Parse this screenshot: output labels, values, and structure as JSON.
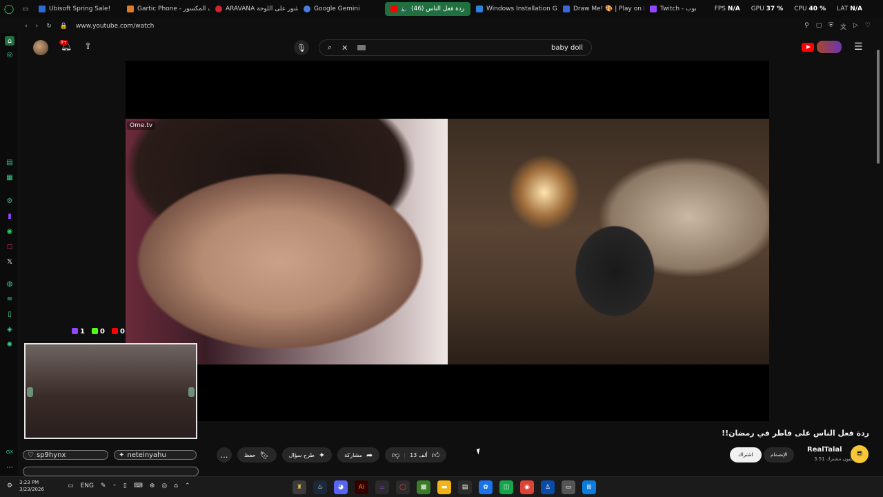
{
  "browser": {
    "tabs": [
      {
        "label": "Ubisoft Spring Sale!",
        "color": "#2b6bd8"
      },
      {
        "label": "Gartic Phone - الهاتف المكسور",
        "color": "#e07a2b"
      },
      {
        "label": "ARAVANA مشور على اللوحة",
        "color": "#d0242f"
      },
      {
        "label": "Google Gemini",
        "color": "#4a7de0"
      },
      {
        "label": "(46) ردة فعل الناس",
        "color": "#ff0000"
      },
      {
        "label": "Windows Installation Guid",
        "color": "#2a82da"
      },
      {
        "label": "Draw Me! 🎨 | Play on Ro",
        "color": "#3a66d8"
      },
      {
        "label": "Twitch - بوب",
        "color": "#9146ff"
      }
    ],
    "url": "www.youtube.com/watch",
    "stats": {
      "fps_label": "FPS",
      "fps": "N/A",
      "gpu_label": "GPU",
      "gpu": "37 %",
      "cpu_label": "CPU",
      "cpu": "40 %",
      "lat_label": "LAT",
      "lat": "N/A"
    }
  },
  "youtube": {
    "notification_count": "9+",
    "search_query": "baby doll",
    "video_overlay_tag": "Ome.tv",
    "counters": {
      "chat": "1",
      "kick": "0",
      "youtube": "0"
    },
    "title": "ردة فعل الناس على فاطر في رمضان!!",
    "actions": {
      "save": "حفظ",
      "ask": "طرح سؤال",
      "share": "مشاركة",
      "likes": "13 ألف",
      "more": "…"
    },
    "channel": {
      "name": "RealTalal",
      "subscribers": "3.51 مليون مشترك",
      "subscribe": "اشتراك",
      "join": "الإنضمام",
      "avatar_glyph": "😎"
    }
  },
  "chat_overlay": {
    "user1": "sp9hynx",
    "user2": "neteinyahu"
  },
  "taskbar": {
    "time": "3:23 PM",
    "date": "3/23/2026",
    "lang": "ENG"
  }
}
